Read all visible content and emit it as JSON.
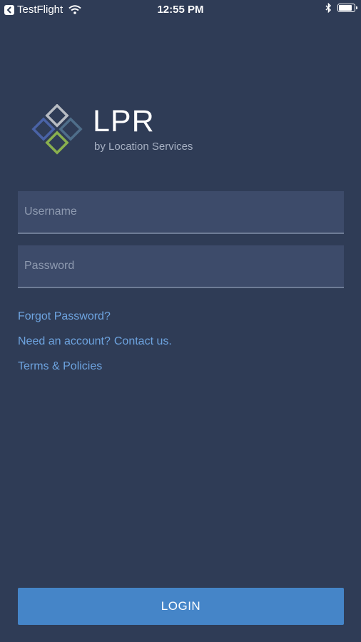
{
  "status_bar": {
    "back_app": "TestFlight",
    "time": "12:55 PM",
    "icons": [
      "back-arrow-icon",
      "wifi-icon",
      "bluetooth-icon",
      "battery-icon"
    ]
  },
  "logo": {
    "title": "LPR",
    "subtitle": "by Location Services",
    "colors": {
      "top": "#b8bcc3",
      "left": "#4a63a6",
      "right": "#4f6e8a",
      "bottom": "#8ab04e"
    }
  },
  "form": {
    "username_placeholder": "Username",
    "username_value": "",
    "password_placeholder": "Password",
    "password_value": ""
  },
  "links": {
    "forgot_password": "Forgot Password?",
    "need_account": "Need an account?",
    "contact_us": "Contact us.",
    "terms": "Terms & Policies"
  },
  "login_label": "LOGIN",
  "colors": {
    "background": "#2f3c56",
    "field": "#3d4b6a",
    "link": "#6ea4e0",
    "button": "#4585c8"
  }
}
